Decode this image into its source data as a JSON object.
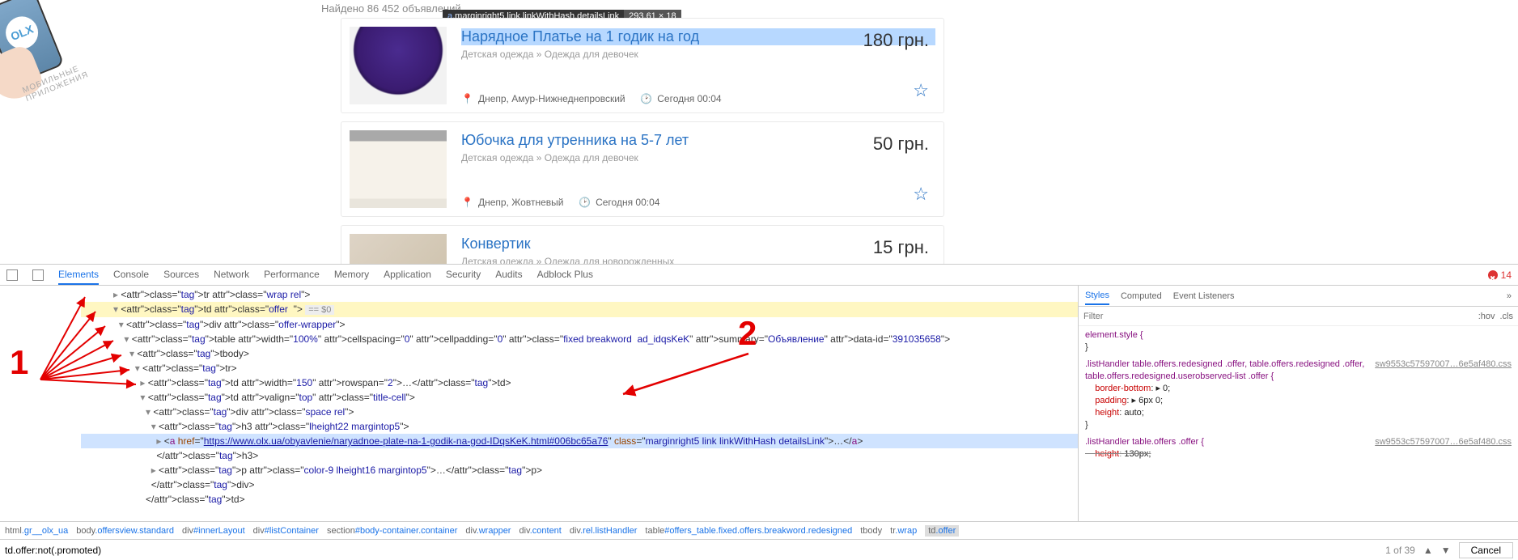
{
  "promo_line1": "МОБИЛЬНЫЕ",
  "promo_line2": "ПРИЛОЖЕНИЯ",
  "found_text": "Найдено 86 452 объявлений",
  "inspect_tip": {
    "selector": "a.marginright5.link.linkWithHash.detailsLink",
    "dims": "293.61 × 18"
  },
  "cards": [
    {
      "title": "Нарядное Платье на 1 годик на год",
      "cat": "Детская одежда » Одежда для девочек",
      "loc": "Днепр, Амур-Нижнеднепровский",
      "time": "Сегодня 00:04",
      "price": "180 грн.",
      "star": true,
      "hl": true,
      "thumb": "dress"
    },
    {
      "title": "Юбочка для утренника на 5-7 лет",
      "cat": "Детская одежда » Одежда для девочек",
      "loc": "Днепр, Жовтневый",
      "time": "Сегодня 00:04",
      "price": "50 грн.",
      "star": true,
      "hl": false,
      "thumb": "skirt"
    },
    {
      "title": "Конвертик",
      "cat": "Детская одежда » Одежда для новорожденных",
      "loc": "",
      "time": "",
      "price": "15 грн.",
      "star": false,
      "hl": false,
      "thumb": "blanket"
    }
  ],
  "dev_tabs": [
    "Elements",
    "Console",
    "Sources",
    "Network",
    "Performance",
    "Memory",
    "Application",
    "Security",
    "Audits",
    "Adblock Plus"
  ],
  "dev_tab_active": "Elements",
  "err_count": "14",
  "sel_hint": "== $0",
  "dom_lines": [
    {
      "indent": 6,
      "tw": "▸",
      "html": "<tr class=\"wrap rel\">"
    },
    {
      "indent": 6,
      "tw": "▾",
      "html": "<td class=\"offer  \">",
      "hl": true,
      "selhint": true
    },
    {
      "indent": 7,
      "tw": "▾",
      "html": "<div class=\"offer-wrapper\">"
    },
    {
      "indent": 8,
      "tw": "▾",
      "html": "<table width=\"100%\" cellspacing=\"0\" cellpadding=\"0\" class=\"fixed breakword  ad_idqsKeK\" summary=\"Объявление\" data-id=\"391035658\">"
    },
    {
      "indent": 9,
      "tw": "▾",
      "html": "<tbody>"
    },
    {
      "indent": 10,
      "tw": "▾",
      "html": "<tr>"
    },
    {
      "indent": 11,
      "tw": "▸",
      "html": "<td width=\"150\" rowspan=\"2\">…</td>"
    },
    {
      "indent": 11,
      "tw": "▾",
      "html": "<td valign=\"top\" class=\"title-cell\">"
    },
    {
      "indent": 12,
      "tw": "▾",
      "html": "<div class=\"space rel\">"
    },
    {
      "indent": 13,
      "tw": "▾",
      "html": "<h3 class=\"lheight22 margintop5\">"
    },
    {
      "indent": 14,
      "tw": "▸",
      "sel": true,
      "link": "https://www.olx.ua/obyavlenie/naryadnoe-plate-na-1-godik-na-god-IDqsKeK.html#006bc65a76",
      "linkclass": "marginright5 link linkWithHash detailsLink"
    },
    {
      "indent": 13,
      "tw": " ",
      "html": "</h3>"
    },
    {
      "indent": 13,
      "tw": "▸",
      "html": "<p class=\"color-9 lheight16 margintop5\">…</p>"
    },
    {
      "indent": 12,
      "tw": " ",
      "html": "</div>"
    },
    {
      "indent": 11,
      "tw": " ",
      "html": "</td>"
    }
  ],
  "annot": {
    "n1": "1",
    "n2": "2"
  },
  "crumbs": [
    "html.gr__olx_ua",
    "body.offersview.standard",
    "div#innerLayout",
    "div#listContainer",
    "section#body-container.container",
    "div.wrapper",
    "div.content",
    "div.rel.listHandler",
    "table#offers_table.fixed.offers.breakword.redesigned",
    "tbody",
    "tr.wrap",
    "td.offer"
  ],
  "find": {
    "value": "td.offer:not(.promoted)",
    "count": "1 of 39",
    "up": "▲",
    "down": "▼",
    "cancel": "Cancel"
  },
  "styles": {
    "tabs": [
      "Styles",
      "Computed",
      "Event Listeners"
    ],
    "active": "Styles",
    "filter_ph": "Filter",
    "hov": ":hov",
    "cls": ".cls",
    "blocks": [
      {
        "selector": "element.style {",
        "props": [],
        "close": "}"
      },
      {
        "src": "sw9553c57597007…6e5af480.css",
        "selector": ".listHandler table.offers.redesigned .offer, table.offers.redesigned .offer, table.offers.redesigned.userobserved-list .offer {",
        "props": [
          {
            "name": "border-bottom",
            "val": "▸ 0;"
          },
          {
            "name": "padding",
            "val": "▸ 6px 0;"
          },
          {
            "name": "height",
            "val": "auto;"
          }
        ],
        "close": "}"
      },
      {
        "src": "sw9553c57597007…6e5af480.css",
        "selector": ".listHandler table.offers .offer {",
        "props": [
          {
            "name": "height",
            "val": "130px;",
            "strike": true
          }
        ],
        "close": ""
      }
    ]
  }
}
